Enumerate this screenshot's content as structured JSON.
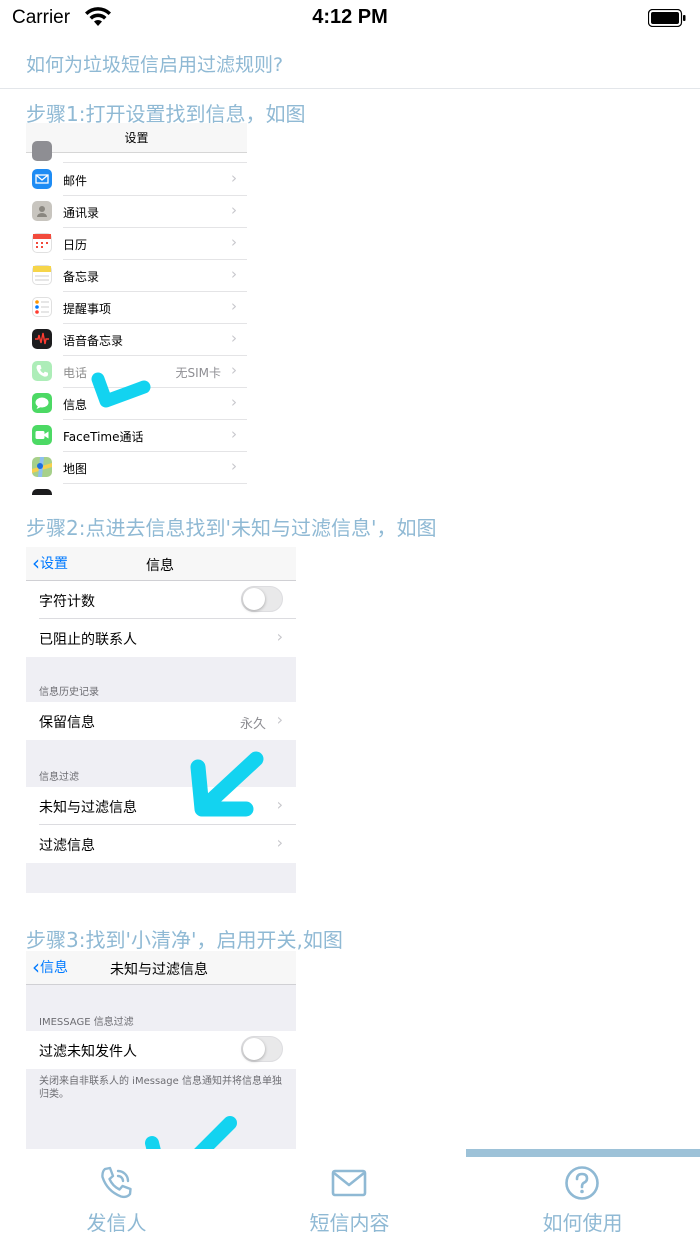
{
  "status_bar": {
    "carrier": "Carrier",
    "time": "4:12 PM"
  },
  "header": {
    "title": "如何为垃圾短信启用过滤规则?"
  },
  "steps": [
    {
      "label": "步骤1:打开设置找到信息，如图"
    },
    {
      "label": "步骤2:点进去信息找到'未知与过滤信息'，如图"
    },
    {
      "label": "步骤3:找到'小清净'，启用开关,如图"
    }
  ],
  "screenshot1": {
    "nav_title": "设置",
    "rows": [
      {
        "label": "邮件",
        "icon": "mail-icon",
        "color": "#1e8cf4"
      },
      {
        "label": "通讯录",
        "icon": "contacts-icon",
        "color": "#b9b6b0"
      },
      {
        "label": "日历",
        "icon": "calendar-icon",
        "color": "#ffffff"
      },
      {
        "label": "备忘录",
        "icon": "notes-icon",
        "color": "#f6d54a"
      },
      {
        "label": "提醒事项",
        "icon": "reminders-icon",
        "color": "#ffffff"
      },
      {
        "label": "语音备忘录",
        "icon": "voice-memo-icon",
        "color": "#1c1c1e"
      },
      {
        "label": "电话",
        "icon": "phone-icon",
        "color": "#4cd964",
        "value": "无SIM卡"
      },
      {
        "label": "信息",
        "icon": "messages-icon",
        "color": "#4cd964"
      },
      {
        "label": "FaceTime通话",
        "icon": "facetime-icon",
        "color": "#4cd964"
      },
      {
        "label": "地图",
        "icon": "maps-icon",
        "color": "#8ec0f0"
      }
    ]
  },
  "screenshot2": {
    "back": "设置",
    "title": "信息",
    "rows": [
      {
        "label": "字符计数"
      },
      {
        "label": "已阻止的联系人"
      },
      {
        "label": "保留信息",
        "value": "永久"
      },
      {
        "label": "未知与过滤信息"
      },
      {
        "label": "过滤信息"
      }
    ],
    "section_history": "信息历史记录",
    "section_filter": "信息过滤"
  },
  "screenshot3": {
    "back": "信息",
    "title": "未知与过滤信息",
    "section": "IMESSAGE 信息过滤",
    "row": "过滤未知发件人",
    "footer": "关闭来自非联系人的 iMessage 信息通知并将信息单独归类。"
  },
  "tabs": [
    {
      "label": "发信人",
      "icon": "phone-icon"
    },
    {
      "label": "短信内容",
      "icon": "mail-icon"
    },
    {
      "label": "如何使用",
      "icon": "help-icon",
      "selected": true
    }
  ],
  "colors": {
    "accent": "#8fb9d4",
    "arrow": "#13d3f0",
    "ios_blue": "#007aff"
  }
}
